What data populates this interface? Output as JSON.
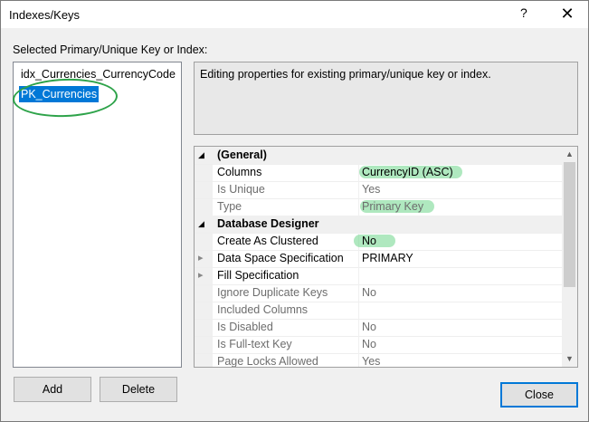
{
  "window": {
    "title": "Indexes/Keys",
    "help_label": "?",
    "close_label": "✕"
  },
  "left_panel": {
    "label": "Selected Primary/Unique Key or Index:",
    "items": [
      {
        "label": "idx_Currencies_CurrencyCode",
        "selected": false
      },
      {
        "label": "PK_Currencies",
        "selected": true
      }
    ]
  },
  "description": "Editing properties for existing primary/unique key or index.",
  "properties": [
    {
      "type": "category",
      "label": "(General)"
    },
    {
      "type": "prop",
      "label": "Columns",
      "value": "CurrencyID (ASC)"
    },
    {
      "type": "prop",
      "label": "Is Unique",
      "value": "Yes",
      "disabled": true
    },
    {
      "type": "prop",
      "label": "Type",
      "value": "Primary Key",
      "disabled": true
    },
    {
      "type": "category",
      "label": "Database Designer"
    },
    {
      "type": "prop",
      "label": "Create As Clustered",
      "value": "No"
    },
    {
      "type": "prop",
      "label": "Data Space Specification",
      "value": "PRIMARY",
      "expandable": true
    },
    {
      "type": "prop",
      "label": "Fill Specification",
      "value": "",
      "expandable": true
    },
    {
      "type": "prop",
      "label": "Ignore Duplicate Keys",
      "value": "No",
      "disabled": true
    },
    {
      "type": "prop",
      "label": "Included Columns",
      "value": "",
      "disabled": true
    },
    {
      "type": "prop",
      "label": "Is Disabled",
      "value": "No",
      "disabled": true
    },
    {
      "type": "prop",
      "label": "Is Full-text Key",
      "value": "No",
      "disabled": true
    },
    {
      "type": "prop",
      "label": "Page Locks Allowed",
      "value": "Yes",
      "disabled": true
    }
  ],
  "buttons": {
    "add": "Add",
    "delete": "Delete",
    "close": "Close"
  },
  "icons": {
    "expand": "▸",
    "collapse": "◢",
    "scroll_up": "▲",
    "scroll_down": "▼"
  },
  "colors": {
    "selection": "#0078d7",
    "highlight_marker": "#6ed68a",
    "annotation_ring": "#2ea34a"
  }
}
